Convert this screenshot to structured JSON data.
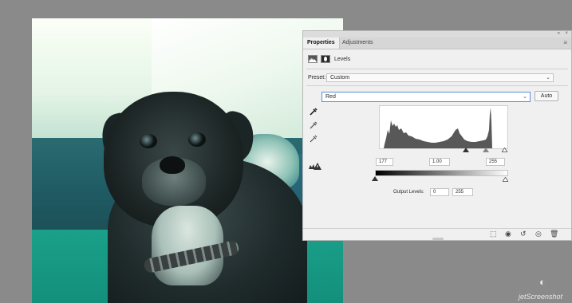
{
  "panel": {
    "tabs": [
      {
        "label": "Properties",
        "active": true
      },
      {
        "label": "Adjustments",
        "active": false
      }
    ],
    "menu_icon": "panel-menu-icon",
    "adjustment_name": "Levels",
    "preset_label": "Preset:",
    "preset_value": "Custom",
    "channel_value": "Red",
    "auto_label": "Auto",
    "input_levels": {
      "black": "177",
      "gamma": "1.00",
      "white": "255"
    },
    "output_label": "Output Levels:",
    "output_levels": {
      "black": "0",
      "white": "255"
    },
    "histogram_color": "#585858",
    "bottom_icons": [
      "clip-to-layer-icon",
      "view-previous-icon",
      "reset-icon",
      "visibility-icon",
      "delete-icon"
    ]
  },
  "watermark": {
    "text": "jetScreenshot"
  }
}
